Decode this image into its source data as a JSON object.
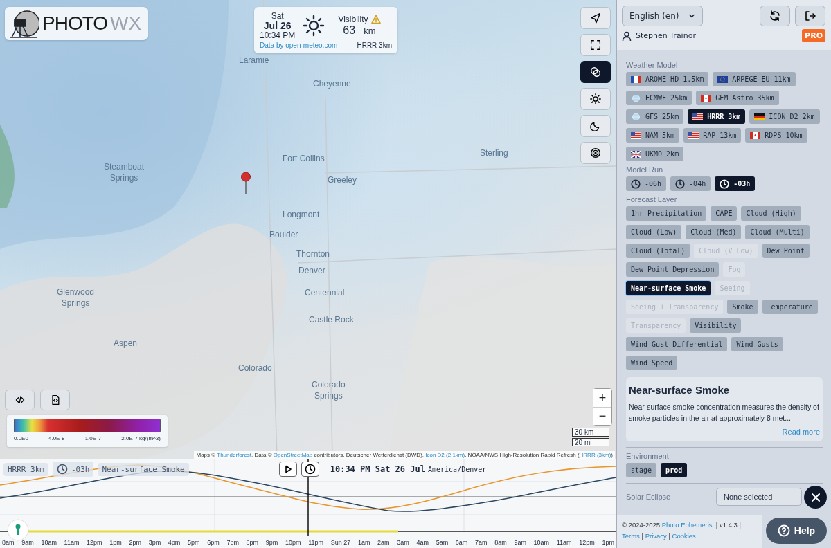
{
  "logo": {
    "word1": "PHOTO",
    "word2": "WX"
  },
  "conditions": {
    "day": "Sat",
    "date": "Jul 26",
    "time": "10:34 PM",
    "metric_label": "Visibility",
    "warning": true,
    "value": "63",
    "unit": "km",
    "source_link": "Data by open-meteo.com",
    "model": "HRRR 3km"
  },
  "map": {
    "cities": [
      {
        "name": "Laramie"
      },
      {
        "name": "Cheyenne"
      },
      {
        "name": "Steamboat\nSprings"
      },
      {
        "name": "Fort Collins"
      },
      {
        "name": "Greeley"
      },
      {
        "name": "Sterling"
      },
      {
        "name": "Longmont"
      },
      {
        "name": "Boulder"
      },
      {
        "name": "Thornton"
      },
      {
        "name": "Denver"
      },
      {
        "name": "Centennial"
      },
      {
        "name": "Glenwood\nSprings"
      },
      {
        "name": "Castle Rock"
      },
      {
        "name": "Aspen"
      },
      {
        "name": "Colorado"
      },
      {
        "name": "Colorado\nSprings"
      }
    ],
    "legend": {
      "ticks": [
        "0.0E0",
        "4.0E-8",
        "1.0E-7",
        "2.0E-7 kg/(m^3)"
      ]
    },
    "zoom": [
      "+",
      "−"
    ],
    "scale": [
      "30 km",
      "20 mi"
    ],
    "attribution": [
      {
        "kind": "text",
        "text": "Maps © "
      },
      {
        "kind": "link",
        "text": "Thunderforest"
      },
      {
        "kind": "text",
        "text": ", Data © "
      },
      {
        "kind": "link",
        "text": "OpenStreetMap"
      },
      {
        "kind": "text",
        "text": " contributors, Deutscher Wetterdienst (DWD), "
      },
      {
        "kind": "link",
        "text": "Icon D2 (2.1km)"
      },
      {
        "kind": "text",
        "text": ", NOAA/NWS High-Resolution Rapid Refresh ("
      },
      {
        "kind": "link",
        "text": "HRRR (3km)"
      },
      {
        "kind": "text",
        "text": ")"
      }
    ]
  },
  "map_controls": [
    {
      "kind": "locate",
      "selected": false
    },
    {
      "kind": "fullscreen",
      "selected": false
    },
    {
      "kind": "layers",
      "selected": true
    },
    {
      "kind": "sun",
      "selected": false
    },
    {
      "kind": "moon",
      "selected": false
    },
    {
      "kind": "target",
      "selected": false
    }
  ],
  "map_tools": [
    {
      "kind": "code"
    },
    {
      "kind": "file-code"
    }
  ],
  "timeline": {
    "chips": [
      {
        "kind": "model",
        "text": "HRRR 3km"
      },
      {
        "kind": "run",
        "text": "-03h"
      },
      {
        "kind": "layer",
        "text": "Near-surface Smoke"
      }
    ],
    "time": "10:34 PM Sat 26 Jul",
    "timezone": "America/Denver",
    "hours": [
      "8am",
      "9am",
      "10am",
      "11am",
      "12pm",
      "1pm",
      "2pm",
      "3pm",
      "4pm",
      "5pm",
      "6pm",
      "7pm",
      "8pm",
      "9pm",
      "10pm",
      "11pm",
      "Sun 27",
      "1am",
      "2am",
      "3am",
      "4am",
      "5am",
      "6am",
      "7am",
      "8am",
      "9am",
      "10am",
      "11am",
      "12pm",
      "1pm"
    ]
  },
  "panel": {
    "language": "English (en)",
    "user": "Stephen Trainor",
    "badge": "PRO",
    "weather_model": {
      "title": "Weather Model",
      "items": [
        {
          "label": "AROME HD 1.5km",
          "kind": "fr",
          "selected": false
        },
        {
          "label": "ARPEGE EU 11km",
          "kind": "eu",
          "selected": false
        },
        {
          "label": "ECMWF 25km",
          "kind": "globe",
          "selected": false
        },
        {
          "label": "GEM Astro 35km",
          "kind": "ca",
          "selected": false
        },
        {
          "label": "GFS 25km",
          "kind": "globe",
          "selected": false
        },
        {
          "label": "HRRR 3km",
          "kind": "us",
          "selected": true
        },
        {
          "label": "ICON D2 2km",
          "kind": "de",
          "selected": false
        },
        {
          "label": "NAM 5km",
          "kind": "us",
          "selected": false
        },
        {
          "label": "RAP 13km",
          "kind": "us",
          "selected": false
        },
        {
          "label": "RDPS 10km",
          "kind": "ca",
          "selected": false
        },
        {
          "label": "UKMO 2km",
          "kind": "gb",
          "selected": false
        }
      ]
    },
    "model_run": {
      "title": "Model Run",
      "items": [
        {
          "label": "-06h",
          "selected": false
        },
        {
          "label": "-04h",
          "selected": false
        },
        {
          "label": "-03h",
          "selected": true
        }
      ]
    },
    "forecast_layer": {
      "title": "Forecast Layer",
      "items": [
        {
          "label": "1hr Precipitation",
          "selected": false,
          "disabled": false
        },
        {
          "label": "CAPE",
          "selected": false,
          "disabled": false
        },
        {
          "label": "Cloud (High)",
          "selected": false,
          "disabled": false
        },
        {
          "label": "Cloud (Low)",
          "selected": false,
          "disabled": false
        },
        {
          "label": "Cloud (Med)",
          "selected": false,
          "disabled": false
        },
        {
          "label": "Cloud (Multi)",
          "selected": false,
          "disabled": false
        },
        {
          "label": "Cloud (Total)",
          "selected": false,
          "disabled": false
        },
        {
          "label": "Cloud (V Low)",
          "selected": false,
          "disabled": true
        },
        {
          "label": "Dew Point",
          "selected": false,
          "disabled": false
        },
        {
          "label": "Dew Point Depression",
          "selected": false,
          "disabled": false
        },
        {
          "label": "Fog",
          "selected": false,
          "disabled": true
        },
        {
          "label": "Near-surface Smoke",
          "selected": true,
          "disabled": false
        },
        {
          "label": "Seeing",
          "selected": false,
          "disabled": true
        },
        {
          "label": "Seeing + Transparency",
          "selected": false,
          "disabled": true
        },
        {
          "label": "Smoke",
          "selected": false,
          "disabled": false
        },
        {
          "label": "Temperature",
          "selected": false,
          "disabled": false
        },
        {
          "label": "Transparency",
          "selected": false,
          "disabled": true
        },
        {
          "label": "Visibility",
          "selected": false,
          "disabled": false
        },
        {
          "label": "Wind Gust Differential",
          "selected": false,
          "disabled": false
        },
        {
          "label": "Wind Gusts",
          "selected": false,
          "disabled": false
        },
        {
          "label": "Wind Speed",
          "selected": false,
          "disabled": false
        }
      ]
    },
    "description": {
      "title": "Near-surface Smoke",
      "text": "Near-surface smoke concentration measures the density of smoke particles in the air at approximately 8 met...",
      "link": "Read more"
    },
    "environment": {
      "title": "Environment",
      "items": [
        {
          "label": "stage",
          "selected": false
        },
        {
          "label": "prod",
          "selected": true
        }
      ]
    },
    "solar_eclipse": {
      "label": "Solar Eclipse",
      "value": "None selected"
    },
    "footer": [
      {
        "kind": "text",
        "text": "© 2024-2025 "
      },
      {
        "kind": "link",
        "text": "Photo Ephemeris."
      },
      {
        "kind": "text",
        "text": " | v1.4.3 | "
      },
      {
        "kind": "link",
        "text": "Terms"
      },
      {
        "kind": "text",
        "text": " | "
      },
      {
        "kind": "link",
        "text": "Privacy"
      },
      {
        "kind": "text",
        "text": " | "
      },
      {
        "kind": "link",
        "text": "Cookies"
      }
    ],
    "help": "Help"
  }
}
